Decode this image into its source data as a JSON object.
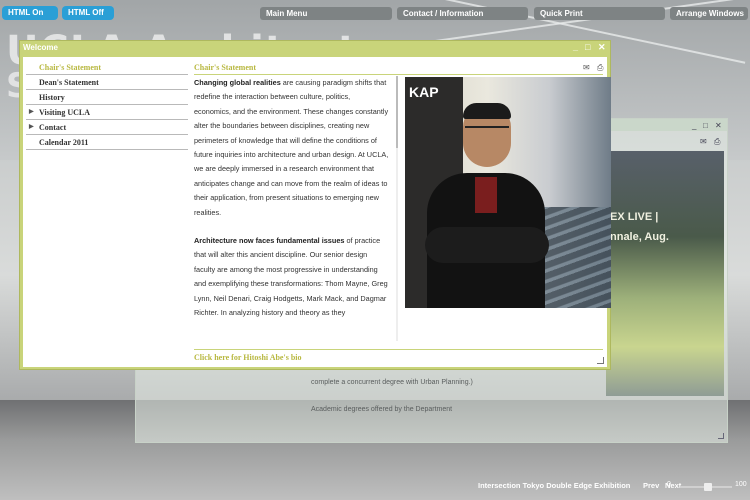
{
  "background": {
    "title_line1": "UCLA Architect",
    "title_line2": "S"
  },
  "topbar": {
    "html_on": "HTML On",
    "html_off": "HTML Off",
    "main_menu": "Main Menu",
    "contact": "Contact / Information",
    "quick_print": "Quick Print",
    "arrange": "Arrange Windows"
  },
  "bg_window": {
    "image_text1": "EX LIVE |",
    "image_text2": "nnale, Aug.",
    "text1": "complete a concurrent degree with Urban Planning.)",
    "text2": "Academic degrees offered by the Department"
  },
  "window": {
    "title": "Welcome",
    "controls": [
      "_",
      "□",
      "✕"
    ],
    "nav": [
      {
        "label": "Chair's Statement",
        "arrow": false,
        "active": true
      },
      {
        "label": "Dean's Statement",
        "arrow": false,
        "active": false
      },
      {
        "label": "History",
        "arrow": false,
        "active": false
      },
      {
        "label": "Visiting UCLA",
        "arrow": true,
        "active": false
      },
      {
        "label": "Contact",
        "arrow": true,
        "active": false
      },
      {
        "label": "Calendar 2011",
        "arrow": false,
        "active": false
      }
    ],
    "content_heading": "Chair's Statement",
    "para1_bold": "Changing global realities",
    "para1_rest": " are causing paradigm shifts that redefine the interaction between culture, politics, economics, and the environment. These changes constantly alter the boundaries between disciplines, creating new perimeters of knowledge that will define the conditions of future inquiries into architecture and urban design. At UCLA, we are deeply immersed in a research environment that anticipates change and can move from the realm of ideas to their application, from present situations to emerging new realities.",
    "para2_bold": "Architecture now faces fundamental issues",
    "para2_rest": " of practice that will alter this ancient discipline. Our senior design faculty are among the most progressive in understanding and exemplifying these transformations: Thom Mayne, Greg Lynn, Neil Denari, Craig Hodgetts, Mark Mack, and Dagmar Richter.  In analyzing history and theory as they",
    "photo_poster_text": "KAP",
    "bio_link": "Click here for Hitoshi Abe's bio"
  },
  "bottombar": {
    "caption": "Intersection Tokyo Double Edge Exhibition",
    "prev": "Prev",
    "next": "Next",
    "slider_min": "0",
    "slider_max": "100"
  }
}
